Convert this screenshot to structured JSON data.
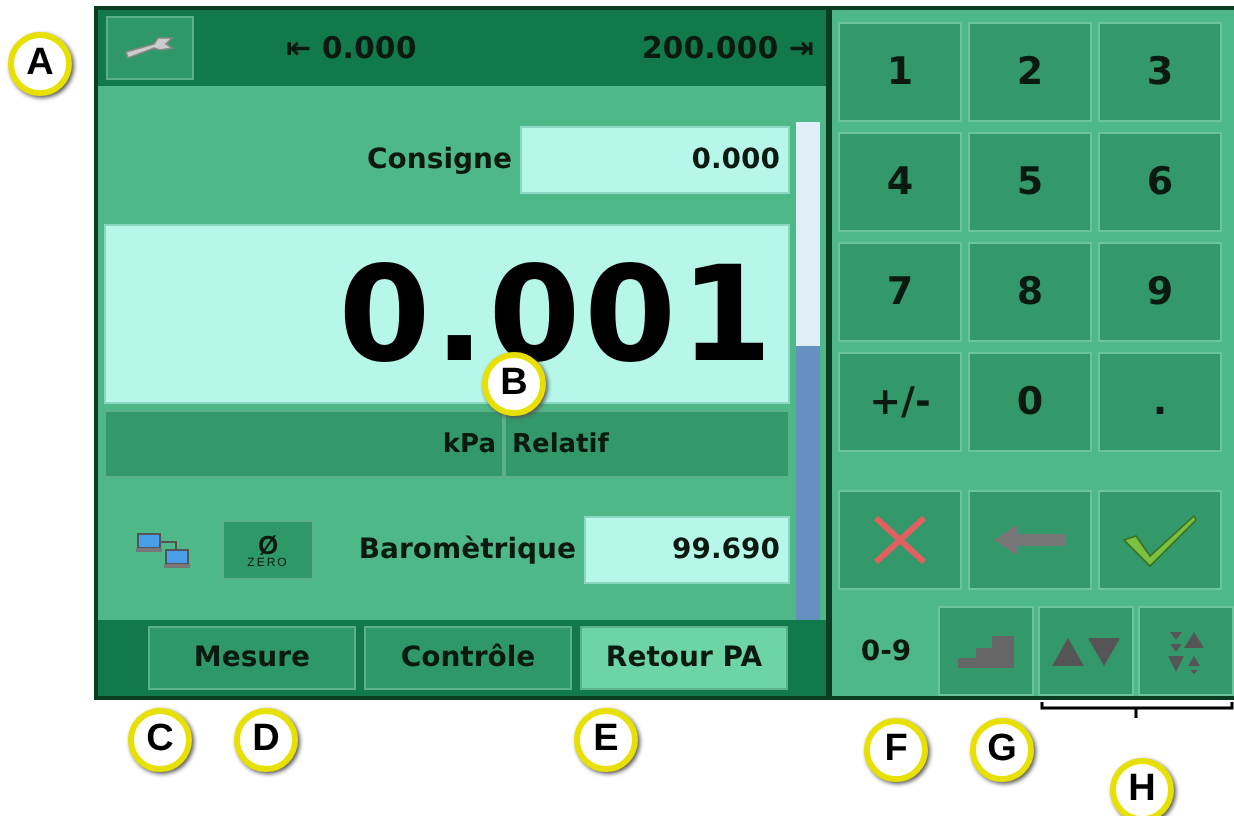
{
  "top_bar": {
    "min_symbol": "⇤",
    "min": "0.000",
    "max": "200.000",
    "max_symbol": "⇥"
  },
  "setpoint": {
    "label": "Consigne",
    "value": "0.000"
  },
  "reading": {
    "value": "0.001",
    "unit": "kPa",
    "mode": "Relatif"
  },
  "scrollbar": {
    "level": 0.55
  },
  "zero_button": {
    "symbol": "Ø",
    "caption": "ZERO"
  },
  "barometric": {
    "label": "Baromètrique",
    "value": "99.690"
  },
  "tabs": [
    {
      "label": "Mesure",
      "selected": false
    },
    {
      "label": "Contrôle",
      "selected": false
    },
    {
      "label": "Retour PA",
      "selected": true
    }
  ],
  "keys": [
    "1",
    "2",
    "3",
    "4",
    "5",
    "6",
    "7",
    "8",
    "9",
    "+/-",
    "0",
    "."
  ],
  "action_keys": [
    {
      "kind": "cancel"
    },
    {
      "kind": "backspace"
    },
    {
      "kind": "confirm"
    }
  ],
  "modes": [
    {
      "kind": "text",
      "label": "0-9",
      "selected": true
    },
    {
      "kind": "steps",
      "selected": false
    },
    {
      "kind": "arrows",
      "selected": false
    },
    {
      "kind": "spread",
      "selected": false
    }
  ],
  "callouts": [
    {
      "letter": "A"
    },
    {
      "letter": "B"
    },
    {
      "letter": "C"
    },
    {
      "letter": "D"
    },
    {
      "letter": "E"
    },
    {
      "letter": "F"
    },
    {
      "letter": "G"
    },
    {
      "letter": "H"
    }
  ]
}
